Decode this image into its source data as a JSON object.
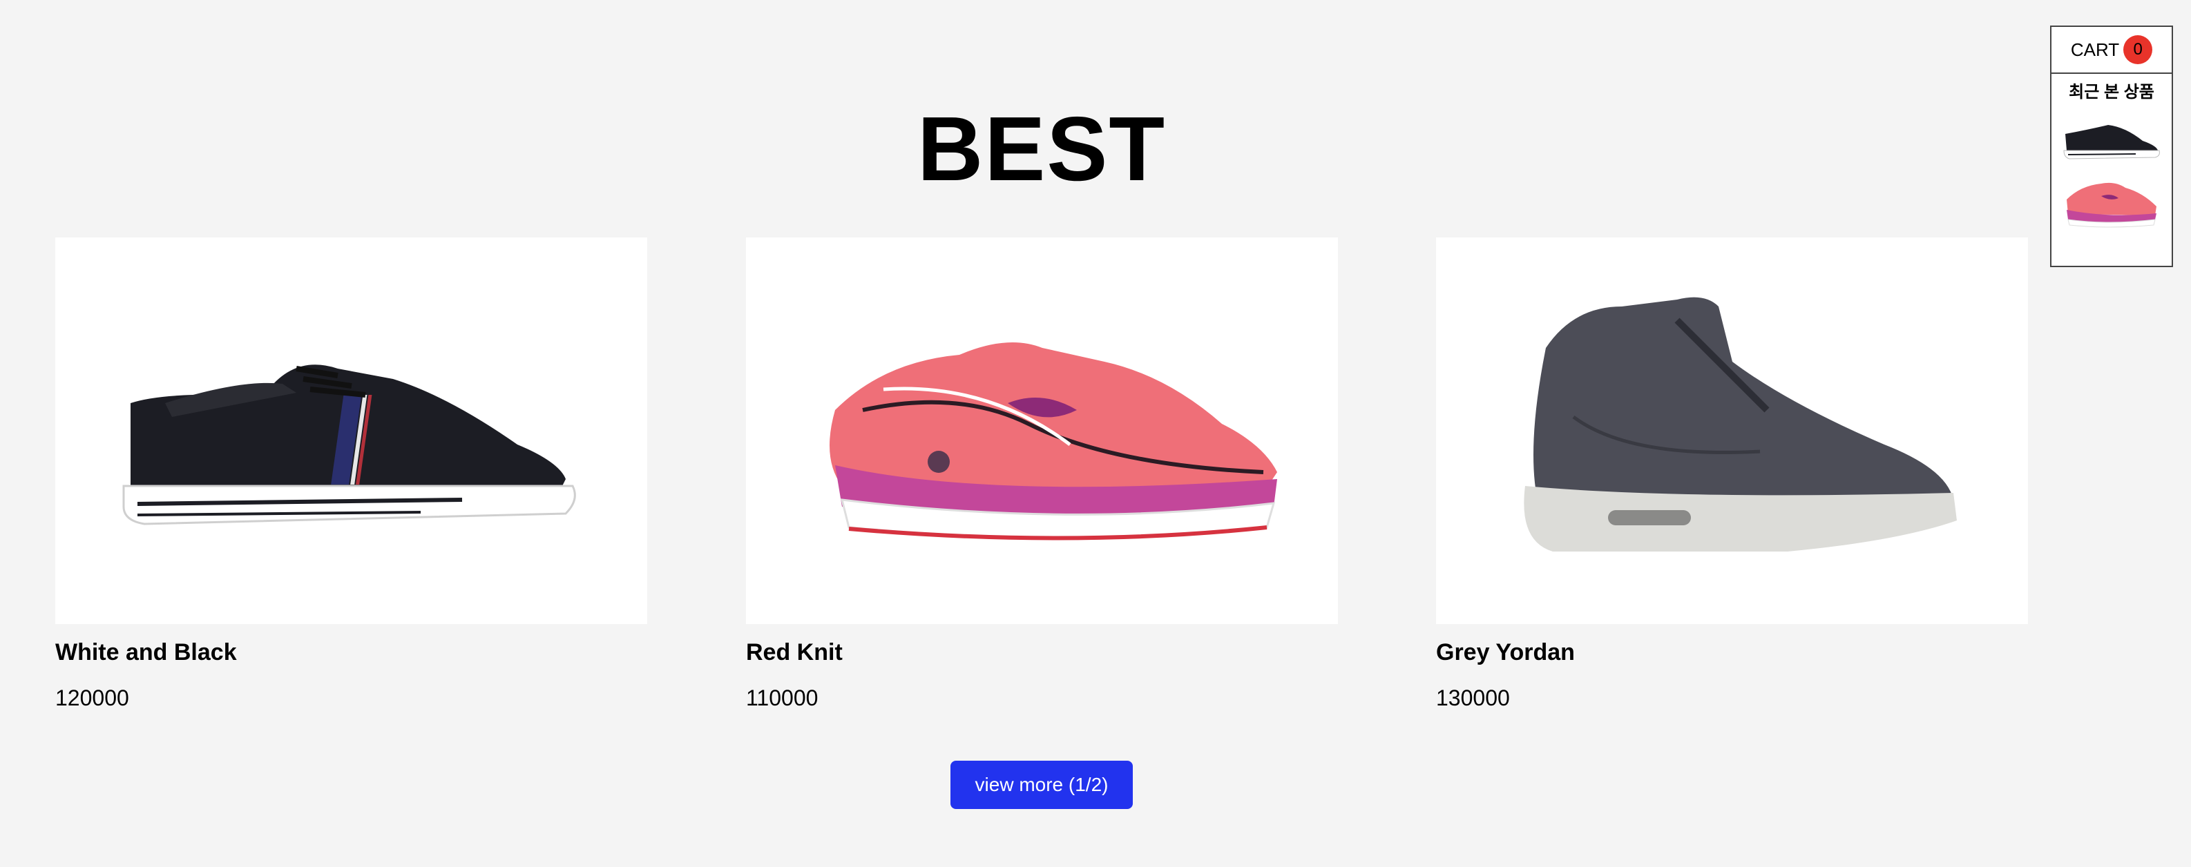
{
  "section": {
    "title": "BEST"
  },
  "products": [
    {
      "name": "White and Black",
      "price": "120000",
      "image": "black-canvas-sneaker"
    },
    {
      "name": "Red Knit",
      "price": "110000",
      "image": "pink-running-shoe"
    },
    {
      "name": "Grey Yordan",
      "price": "130000",
      "image": "grey-wool-high-top"
    }
  ],
  "view_more": {
    "label": "view more (1/2)"
  },
  "sidebar": {
    "cart_label": "CART",
    "cart_count": "0",
    "recent_title": "최근 본 상품",
    "recent_items": [
      "black-canvas-sneaker",
      "pink-running-shoe"
    ]
  },
  "colors": {
    "background": "#f4f4f4",
    "button": "#2233ee",
    "badge": "#e8332a"
  }
}
